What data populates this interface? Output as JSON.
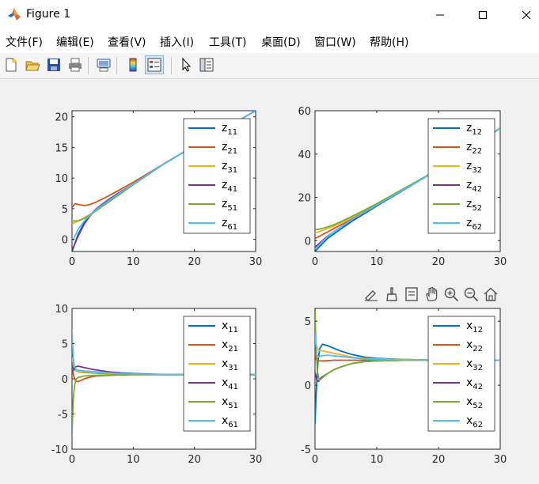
{
  "window": {
    "title": "Figure 1"
  },
  "menu": [
    "文件(F)",
    "编辑(E)",
    "查看(V)",
    "插入(I)",
    "工具(T)",
    "桌面(D)",
    "窗口(W)",
    "帮助(H)"
  ],
  "toolbar": {
    "icons": [
      "new-figure-icon",
      "open-file-icon",
      "save-icon",
      "print-icon",
      "print-preview-icon",
      "colorbar-icon",
      "legend-icon",
      "pointer-icon",
      "property-editor-icon"
    ]
  },
  "axes_toolbar": {
    "icons": [
      "brush-edit-icon",
      "data-brush-icon",
      "data-tip-icon",
      "pan-hand-icon",
      "zoom-in-icon",
      "zoom-out-icon",
      "home-icon"
    ]
  },
  "colors": [
    "#0072BD",
    "#D95319",
    "#EDB120",
    "#7E2F8E",
    "#77AC30",
    "#4DBEEE"
  ],
  "chart_data": [
    {
      "type": "line",
      "xlim": [
        0,
        30
      ],
      "ylim": [
        -2,
        21
      ],
      "xticks": [
        "0",
        "10",
        "20",
        "30"
      ],
      "yticks": [
        "0",
        "5",
        "10",
        "15",
        "20"
      ],
      "legend_position": "top-right",
      "legend": [
        {
          "base": "z",
          "sub": "11"
        },
        {
          "base": "z",
          "sub": "21"
        },
        {
          "base": "z",
          "sub": "31"
        },
        {
          "base": "z",
          "sub": "41"
        },
        {
          "base": "z",
          "sub": "51"
        },
        {
          "base": "z",
          "sub": "61"
        }
      ],
      "series": [
        {
          "x": [
            0,
            1,
            2,
            3,
            4,
            6,
            8,
            10,
            15,
            20,
            25,
            30
          ],
          "y": [
            -2,
            0.8,
            2.7,
            4,
            5,
            6.5,
            7.8,
            9,
            12.3,
            15.3,
            18.1,
            21
          ]
        },
        {
          "x": [
            0,
            0.5,
            1,
            2,
            3,
            4,
            6,
            8,
            10,
            15,
            20,
            25,
            30
          ],
          "y": [
            5.2,
            5.8,
            5.7,
            5.5,
            5.7,
            6.1,
            7.1,
            8.2,
            9.3,
            12.3,
            15.3,
            18.1,
            21
          ]
        },
        {
          "x": [
            0,
            1,
            2,
            3,
            4,
            6,
            8,
            10,
            15,
            20,
            25,
            30
          ],
          "y": [
            2.5,
            3,
            3.5,
            4.1,
            4.8,
            6.2,
            7.6,
            8.9,
            12.3,
            15.3,
            18.1,
            21
          ]
        },
        {
          "x": [
            0,
            1,
            2,
            3,
            4,
            6,
            8,
            10,
            15,
            20,
            25,
            30
          ],
          "y": [
            -1.8,
            0.5,
            2.5,
            3.9,
            5,
            6.5,
            7.8,
            9,
            12.3,
            15.3,
            18.1,
            21
          ]
        },
        {
          "x": [
            0,
            1,
            2,
            3,
            4,
            6,
            8,
            10,
            15,
            20,
            25,
            30
          ],
          "y": [
            3,
            3,
            3.4,
            4,
            4.7,
            6.1,
            7.5,
            8.9,
            12.3,
            15.3,
            18.1,
            21
          ]
        },
        {
          "x": [
            0,
            1,
            2,
            3,
            4,
            6,
            8,
            10,
            15,
            20,
            25,
            30
          ],
          "y": [
            -0.5,
            1.6,
            3,
            4,
            4.9,
            6.3,
            7.7,
            9,
            12.3,
            15.3,
            18.1,
            21
          ]
        }
      ]
    },
    {
      "type": "line",
      "xlim": [
        0,
        30
      ],
      "ylim": [
        -5,
        60
      ],
      "xticks": [
        "0",
        "10",
        "20",
        "30"
      ],
      "yticks": [
        "0",
        "20",
        "40",
        "60"
      ],
      "legend_position": "top-right",
      "legend": [
        {
          "base": "z",
          "sub": "12"
        },
        {
          "base": "z",
          "sub": "22"
        },
        {
          "base": "z",
          "sub": "32"
        },
        {
          "base": "z",
          "sub": "42"
        },
        {
          "base": "z",
          "sub": "52"
        },
        {
          "base": "z",
          "sub": "62"
        }
      ],
      "series": [
        {
          "x": [
            0,
            1,
            2,
            3,
            4,
            6,
            8,
            10,
            15,
            20,
            25,
            30
          ],
          "y": [
            -5,
            -2,
            1,
            3,
            5,
            9,
            12.5,
            16,
            24.5,
            33,
            42,
            52
          ]
        },
        {
          "x": [
            0,
            1,
            2,
            3,
            4,
            6,
            8,
            10,
            15,
            20,
            25,
            30
          ],
          "y": [
            1,
            2.5,
            4,
            5.5,
            7,
            10,
            13.3,
            16.6,
            24.8,
            33,
            42,
            52
          ]
        },
        {
          "x": [
            0,
            1,
            2,
            3,
            4,
            6,
            8,
            10,
            15,
            20,
            25,
            30
          ],
          "y": [
            3.5,
            4.5,
            5.5,
            6.7,
            8,
            10.8,
            13.8,
            16.9,
            24.9,
            33,
            42,
            52
          ]
        },
        {
          "x": [
            0,
            1,
            2,
            3,
            4,
            6,
            8,
            10,
            15,
            20,
            25,
            30
          ],
          "y": [
            -3,
            -0.5,
            2,
            4,
            6,
            9.5,
            13,
            16.3,
            24.6,
            33,
            42,
            52
          ]
        },
        {
          "x": [
            0,
            1,
            2,
            3,
            4,
            6,
            8,
            10,
            15,
            20,
            25,
            30
          ],
          "y": [
            5,
            5.5,
            6.3,
            7.3,
            8.5,
            11.2,
            14.1,
            17.1,
            25,
            33,
            42,
            52
          ]
        },
        {
          "x": [
            0,
            1,
            2,
            3,
            4,
            6,
            8,
            10,
            15,
            20,
            25,
            30
          ],
          "y": [
            -4,
            -1,
            1.8,
            4,
            6,
            9.7,
            13.1,
            16.4,
            24.6,
            33,
            42,
            52
          ]
        }
      ]
    },
    {
      "type": "line",
      "xlim": [
        0,
        30
      ],
      "ylim": [
        -10,
        10
      ],
      "xticks": [
        "0",
        "10",
        "20",
        "30"
      ],
      "yticks": [
        "-10",
        "-5",
        "0",
        "5",
        "10"
      ],
      "legend_position": "top-right",
      "legend": [
        {
          "base": "x",
          "sub": "11"
        },
        {
          "base": "x",
          "sub": "21"
        },
        {
          "base": "x",
          "sub": "31"
        },
        {
          "base": "x",
          "sub": "41"
        },
        {
          "base": "x",
          "sub": "51"
        },
        {
          "base": "x",
          "sub": "61"
        }
      ],
      "series": [
        {
          "x": [
            0,
            0.2,
            0.5,
            1,
            2,
            3,
            4,
            6,
            8,
            10,
            15,
            20,
            30
          ],
          "y": [
            2,
            1.5,
            1.2,
            1,
            0.9,
            0.85,
            0.8,
            0.75,
            0.7,
            0.65,
            0.6,
            0.6,
            0.6
          ]
        },
        {
          "x": [
            0,
            0.3,
            0.6,
            1,
            2,
            3,
            4,
            6,
            8,
            10,
            15,
            20,
            30
          ],
          "y": [
            1.5,
            0.3,
            -0.3,
            -0.4,
            0,
            0.25,
            0.4,
            0.5,
            0.55,
            0.58,
            0.6,
            0.6,
            0.6
          ]
        },
        {
          "x": [
            0,
            0.3,
            0.6,
            1,
            2,
            3,
            4,
            6,
            8,
            10,
            15,
            20,
            30
          ],
          "y": [
            3,
            1.8,
            1.2,
            1,
            0.95,
            0.9,
            0.85,
            0.78,
            0.7,
            0.65,
            0.6,
            0.6,
            0.6
          ]
        },
        {
          "x": [
            0,
            0.3,
            0.6,
            1,
            2,
            3,
            4,
            6,
            8,
            10,
            15,
            20,
            30
          ],
          "y": [
            1,
            1.4,
            1.7,
            1.8,
            1.6,
            1.4,
            1.25,
            1,
            0.85,
            0.75,
            0.62,
            0.6,
            0.6
          ]
        },
        {
          "x": [
            0,
            0.2,
            0.4,
            0.7,
            1,
            2,
            3,
            4,
            6,
            8,
            10,
            15,
            30
          ],
          "y": [
            -8,
            -3,
            -1,
            0,
            0.2,
            0.4,
            0.45,
            0.5,
            0.55,
            0.58,
            0.6,
            0.6,
            0.6
          ]
        },
        {
          "x": [
            0,
            0.2,
            0.4,
            0.7,
            1,
            2,
            3,
            4,
            6,
            8,
            10,
            15,
            30
          ],
          "y": [
            7,
            3,
            1.7,
            1.3,
            1.2,
            1.1,
            1.05,
            1,
            0.85,
            0.75,
            0.68,
            0.6,
            0.6
          ]
        }
      ]
    },
    {
      "type": "line",
      "xlim": [
        0,
        30
      ],
      "ylim": [
        -5,
        6
      ],
      "xticks": [
        "0",
        "10",
        "20",
        "30"
      ],
      "yticks": [
        "-5",
        "0",
        "5"
      ],
      "legend_position": "top-right",
      "legend": [
        {
          "base": "x",
          "sub": "12"
        },
        {
          "base": "x",
          "sub": "22"
        },
        {
          "base": "x",
          "sub": "32"
        },
        {
          "base": "x",
          "sub": "42"
        },
        {
          "base": "x",
          "sub": "52"
        },
        {
          "base": "x",
          "sub": "62"
        }
      ],
      "series": [
        {
          "x": [
            0,
            0.2,
            0.5,
            0.8,
            1.2,
            2,
            3,
            4,
            6,
            8,
            10,
            15,
            20,
            30
          ],
          "y": [
            -3,
            -0.5,
            2,
            2.9,
            3.2,
            3.1,
            2.9,
            2.7,
            2.4,
            2.2,
            2.1,
            2,
            1.95,
            1.95
          ]
        },
        {
          "x": [
            0,
            0.2,
            0.4,
            0.8,
            1.5,
            3,
            5,
            8,
            10,
            15,
            20,
            30
          ],
          "y": [
            2.5,
            2,
            1.9,
            1.9,
            1.9,
            1.95,
            1.95,
            1.95,
            1.95,
            1.95,
            1.95,
            1.95
          ]
        },
        {
          "x": [
            0,
            0.3,
            0.6,
            1,
            2,
            3,
            4,
            6,
            8,
            10,
            15,
            20,
            30
          ],
          "y": [
            3.5,
            3,
            2.7,
            2.7,
            2.6,
            2.5,
            2.4,
            2.2,
            2.1,
            2.05,
            2,
            1.95,
            1.95
          ]
        },
        {
          "x": [
            0,
            0.3,
            0.6,
            1,
            2,
            3,
            4,
            6,
            8,
            10,
            15,
            20,
            30
          ],
          "y": [
            1,
            0.4,
            0.3,
            0.6,
            0.9,
            1.2,
            1.4,
            1.7,
            1.85,
            1.9,
            1.95,
            1.95,
            1.95
          ]
        },
        {
          "x": [
            0,
            0.15,
            0.4,
            0.7,
            1,
            2,
            3,
            4,
            6,
            8,
            10,
            15,
            30
          ],
          "y": [
            6,
            3,
            1,
            0.4,
            0.5,
            0.9,
            1.2,
            1.4,
            1.7,
            1.85,
            1.9,
            1.95,
            1.95
          ]
        },
        {
          "x": [
            0,
            0.15,
            0.3,
            0.6,
            1,
            2,
            3,
            4,
            6,
            8,
            10,
            15,
            30
          ],
          "y": [
            4,
            3.2,
            2.4,
            2.2,
            2.3,
            2.35,
            2.3,
            2.25,
            2.15,
            2.05,
            2,
            1.95,
            1.95
          ]
        }
      ]
    }
  ]
}
